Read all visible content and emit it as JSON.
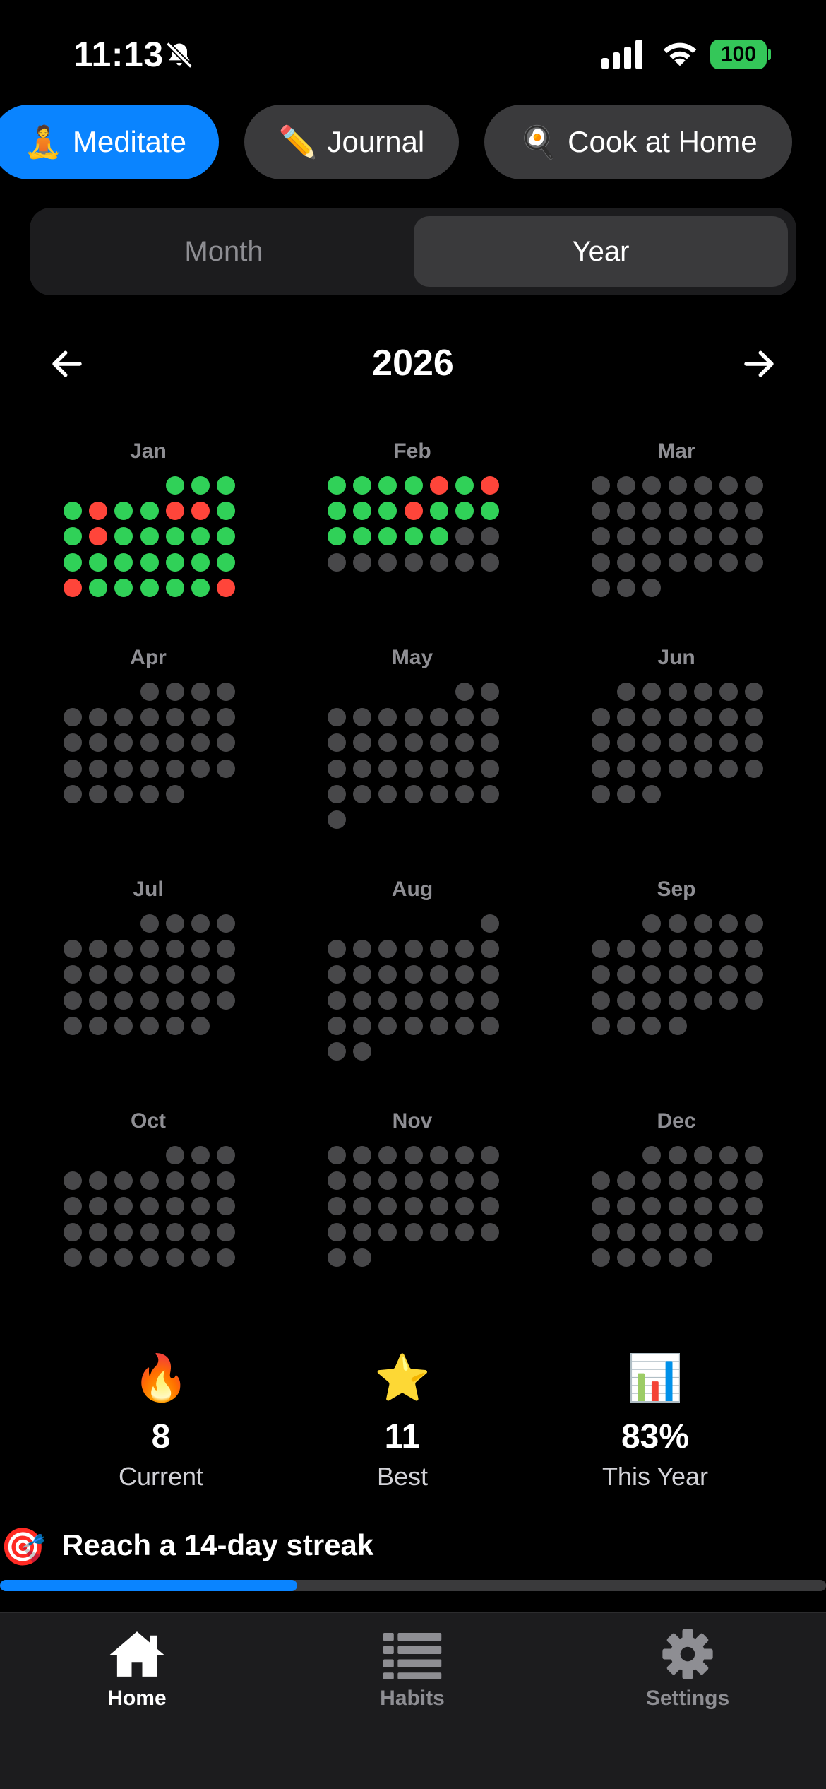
{
  "status_bar": {
    "time": "11:13",
    "battery": "100"
  },
  "habits": [
    {
      "emoji": "🧘",
      "label": "Meditate",
      "active": true
    },
    {
      "emoji": "✏️",
      "label": "Journal",
      "active": false
    },
    {
      "emoji": "🍳",
      "label": "Cook at Home",
      "active": false
    }
  ],
  "segmented": {
    "month_label": "Month",
    "year_label": "Year",
    "selected": "Year"
  },
  "year": "2026",
  "months": [
    {
      "label": "Jan",
      "offset": 4,
      "days": 31,
      "statuses": [
        "g",
        "g",
        "g",
        "g",
        "r",
        "g",
        "g",
        "r",
        "r",
        "g",
        "g",
        "r",
        "g",
        "g",
        "g",
        "g",
        "g",
        "g",
        "g",
        "g",
        "g",
        "g",
        "g",
        "g",
        "r",
        "g",
        "g",
        "g",
        "g",
        "g",
        "r"
      ]
    },
    {
      "label": "Feb",
      "offset": 0,
      "days": 28,
      "statuses": [
        "g",
        "g",
        "g",
        "g",
        "r",
        "g",
        "r",
        "g",
        "g",
        "g",
        "r",
        "g",
        "g",
        "g",
        "g",
        "g",
        "g",
        "g",
        "g"
      ]
    },
    {
      "label": "Mar",
      "offset": 0,
      "days": 31,
      "statuses": []
    },
    {
      "label": "Apr",
      "offset": 3,
      "days": 30,
      "statuses": []
    },
    {
      "label": "May",
      "offset": 5,
      "days": 31,
      "statuses": []
    },
    {
      "label": "Jun",
      "offset": 1,
      "days": 30,
      "statuses": []
    },
    {
      "label": "Jul",
      "offset": 3,
      "days": 31,
      "statuses": []
    },
    {
      "label": "Aug",
      "offset": 6,
      "days": 31,
      "statuses": []
    },
    {
      "label": "Sep",
      "offset": 2,
      "days": 30,
      "statuses": []
    },
    {
      "label": "Oct",
      "offset": 4,
      "days": 31,
      "statuses": []
    },
    {
      "label": "Nov",
      "offset": 0,
      "days": 30,
      "statuses": []
    },
    {
      "label": "Dec",
      "offset": 2,
      "days": 31,
      "statuses": []
    }
  ],
  "colors": {
    "done": "#30d158",
    "missed": "#ff453a",
    "empty": "#48484a",
    "accent": "#0a84ff"
  },
  "stats": [
    {
      "icon": "🔥",
      "value": "8",
      "label": "Current"
    },
    {
      "icon": "⭐",
      "value": "11",
      "label": "Best"
    },
    {
      "icon": "📊",
      "value": "83%",
      "label": "This Year"
    }
  ],
  "goal": {
    "icon": "🎯",
    "text": "Reach a 14-day streak",
    "progress": 0.36
  },
  "tabs": [
    {
      "label": "Home",
      "icon": "home-icon",
      "active": true
    },
    {
      "label": "Habits",
      "icon": "list-icon",
      "active": false
    },
    {
      "label": "Settings",
      "icon": "gear-icon",
      "active": false
    }
  ]
}
